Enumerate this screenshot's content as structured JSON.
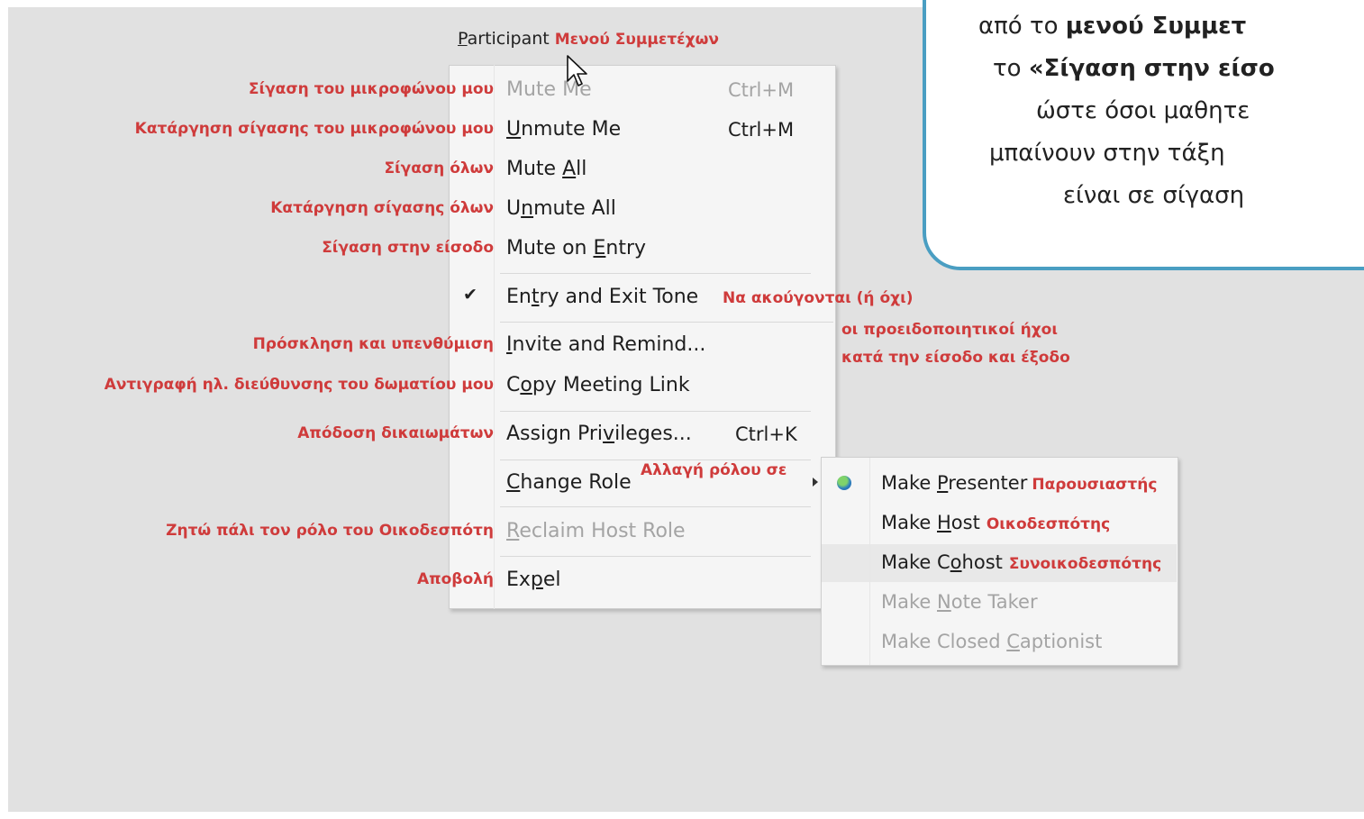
{
  "menubar": {
    "label_pre": "",
    "label_underlined": "P",
    "label_rest": "articipant",
    "note": "Μενού Συμμετέχων"
  },
  "menu": {
    "mute_me": {
      "pre": "Mute ",
      "u": "",
      "post": "Me",
      "shortcut": "Ctrl+M",
      "note": "Σίγαση του μικροφώνου μου"
    },
    "unmute_me": {
      "pre": "",
      "u": "U",
      "post": "nmute Me",
      "shortcut": "Ctrl+M",
      "note": "Κατάργηση σίγασης του μικροφώνου μου"
    },
    "mute_all": {
      "pre": "Mute ",
      "u": "A",
      "post": "ll",
      "note": "Σίγαση όλων"
    },
    "unmute_all": {
      "pre": "U",
      "u": "n",
      "post": "mute All",
      "note": "Κατάργηση σίγασης όλων"
    },
    "mute_on_entry": {
      "pre": "Mute on ",
      "u": "E",
      "post": "ntry",
      "note": "Σίγαση στην είσοδο"
    },
    "entry_exit_tone": {
      "pre": "En",
      "u": "t",
      "post": "ry and Exit Tone",
      "check": "✔",
      "note": "Να ακούγονται (ή όχι)",
      "note2": "οι προειδοποιητικοί ήχοι",
      "note3": "κατά την είσοδο και έξοδο"
    },
    "invite": {
      "pre": "",
      "u": "I",
      "post": "nvite and Remind...",
      "note": "Πρόσκληση και υπενθύμιση"
    },
    "copy_link": {
      "pre": "C",
      "u": "o",
      "post": "py Meeting Link",
      "note": "Αντιγραφή ηλ. διεύθυνσης του δωματίου μου"
    },
    "assign": {
      "pre": "Assign Pri",
      "u": "v",
      "post": "ileges...",
      "shortcut": "Ctrl+K",
      "note": "Απόδοση δικαιωμάτων"
    },
    "change_role": {
      "pre": "",
      "u": "C",
      "post": "hange Role",
      "note": "Αλλαγή ρόλου σε"
    },
    "reclaim": {
      "pre": "",
      "u": "R",
      "post": "eclaim Host Role",
      "note": "Ζητώ πάλι τον ρόλο του Οικοδεσπότη"
    },
    "expel": {
      "pre": "Ex",
      "u": "p",
      "post": "el",
      "note": "Αποβολή"
    }
  },
  "submenu": {
    "presenter": {
      "pre": "Make ",
      "u": "P",
      "post": "resenter",
      "note": "Παρουσιαστής",
      "icon": "presenter-globe-icon"
    },
    "host": {
      "pre": "Make ",
      "u": "H",
      "post": "ost",
      "note": "Οικοδεσπότης"
    },
    "cohost": {
      "pre": "Make C",
      "u": "o",
      "post": "host",
      "note": "Συνοικοδεσπότης"
    },
    "note_taker": {
      "pre": "Make ",
      "u": "N",
      "post": "ote Taker"
    },
    "captionist": {
      "pre": "Make Closed ",
      "u": "C",
      "post": "aptionist"
    }
  },
  "callout": {
    "l1_pre": "από το ",
    "l1_bold": "μενού Συμμετ",
    "l2_pre": "το ",
    "l2_bold": "«Σίγαση στην είσο",
    "l3": "ώστε όσοι μαθητε",
    "l4": "μπαίνουν στην τάξη",
    "l5": "είναι σε σίγαση"
  },
  "colors": {
    "annotation": "#cf3b3b",
    "callout_border": "#4a9ec2",
    "background": "#e1e1e1",
    "menu_bg": "#f5f5f5"
  }
}
